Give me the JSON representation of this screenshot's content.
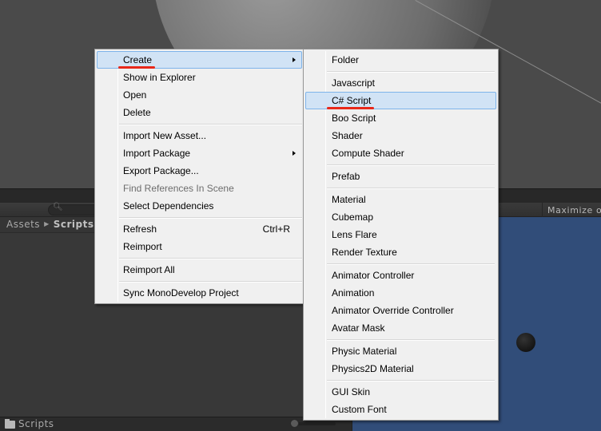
{
  "project_panel": {
    "search": {
      "placeholder": ""
    },
    "breadcrumb": {
      "root": "Assets",
      "current": "Scripts"
    },
    "footer": {
      "folder_label": "Scripts"
    }
  },
  "game_view": {
    "maximize_label": "Maximize on Play",
    "background_color": "#314d79"
  },
  "context_menu": {
    "items": [
      {
        "label": "Create",
        "submenu": true,
        "highlighted": true
      },
      {
        "label": "Show in Explorer"
      },
      {
        "label": "Open"
      },
      {
        "label": "Delete"
      },
      {
        "separator": true
      },
      {
        "label": "Import New Asset..."
      },
      {
        "label": "Import Package",
        "submenu": true
      },
      {
        "label": "Export Package..."
      },
      {
        "label": "Find References In Scene",
        "disabled": true
      },
      {
        "label": "Select Dependencies"
      },
      {
        "separator": true
      },
      {
        "label": "Refresh",
        "shortcut": "Ctrl+R"
      },
      {
        "label": "Reimport"
      },
      {
        "separator": true
      },
      {
        "label": "Reimport All"
      },
      {
        "separator": true
      },
      {
        "label": "Sync MonoDevelop Project"
      }
    ]
  },
  "create_menu": {
    "items": [
      {
        "label": "Folder"
      },
      {
        "separator": true
      },
      {
        "label": "Javascript"
      },
      {
        "label": "C# Script",
        "highlighted": true
      },
      {
        "label": "Boo Script"
      },
      {
        "label": "Shader"
      },
      {
        "label": "Compute Shader"
      },
      {
        "separator": true
      },
      {
        "label": "Prefab"
      },
      {
        "separator": true
      },
      {
        "label": "Material"
      },
      {
        "label": "Cubemap"
      },
      {
        "label": "Lens Flare"
      },
      {
        "label": "Render Texture"
      },
      {
        "separator": true
      },
      {
        "label": "Animator Controller"
      },
      {
        "label": "Animation"
      },
      {
        "label": "Animator Override Controller"
      },
      {
        "label": "Avatar Mask"
      },
      {
        "separator": true
      },
      {
        "label": "Physic Material"
      },
      {
        "label": "Physics2D Material"
      },
      {
        "separator": true
      },
      {
        "label": "GUI Skin"
      },
      {
        "label": "Custom Font"
      }
    ]
  },
  "annotations": {
    "underline_color": "#e8281a"
  }
}
